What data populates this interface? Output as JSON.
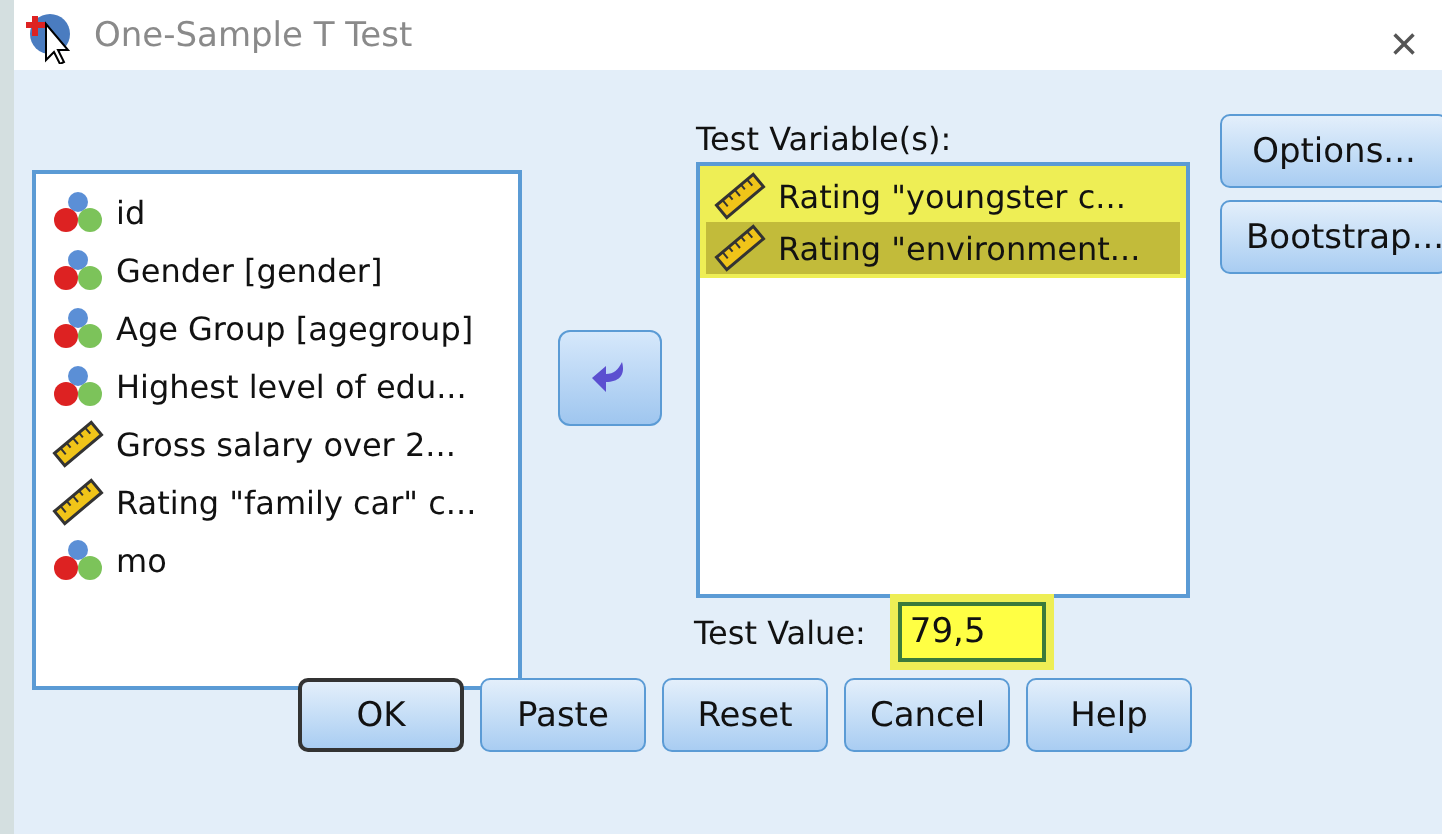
{
  "window": {
    "title": "One-Sample T Test",
    "close": "×"
  },
  "source_list": {
    "items": [
      {
        "label": "id",
        "kind": "nominal"
      },
      {
        "label": "Gender [gender]",
        "kind": "nominal"
      },
      {
        "label": "Age Group [agegroup]",
        "kind": "nominal"
      },
      {
        "label": "Highest level of edu...",
        "kind": "nominal"
      },
      {
        "label": "Gross salary over 2...",
        "kind": "scale"
      },
      {
        "label": "Rating \"family car\" c...",
        "kind": "scale"
      },
      {
        "label": "mo",
        "kind": "nominal"
      }
    ]
  },
  "test_variables": {
    "label": "Test Variable(s):",
    "items": [
      {
        "label": "Rating \"youngster c...",
        "kind": "scale",
        "selected": false
      },
      {
        "label": "Rating \"environment...",
        "kind": "scale",
        "selected": true
      }
    ]
  },
  "side_buttons": [
    "Options...",
    "Bootstrap..."
  ],
  "test_value": {
    "label": "Test Value:",
    "value": "79,5"
  },
  "buttons": [
    {
      "label": "OK",
      "default": true
    },
    {
      "label": "Paste",
      "default": false
    },
    {
      "label": "Reset",
      "default": false
    },
    {
      "label": "Cancel",
      "default": false
    },
    {
      "label": "Help",
      "default": false
    }
  ]
}
